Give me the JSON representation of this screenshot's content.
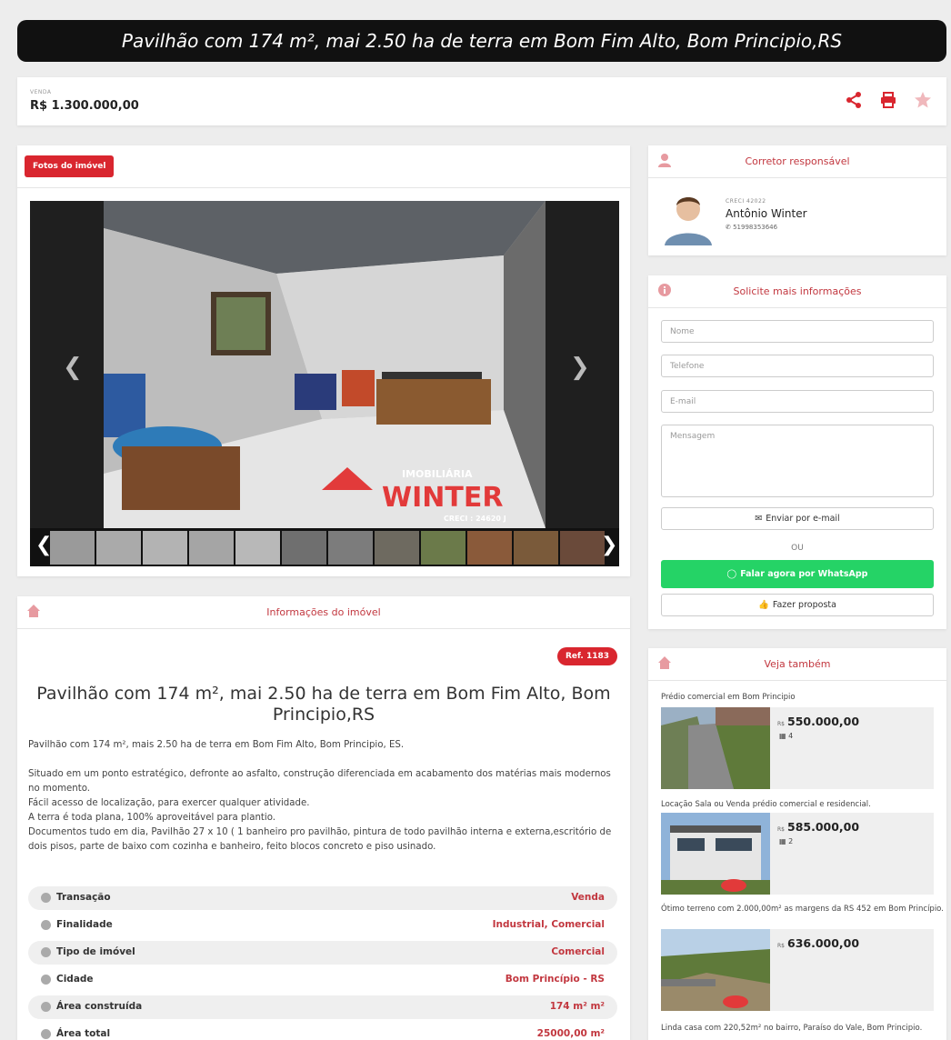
{
  "header": {
    "title": "Pavilhão com 174 m², mai 2.50 ha de terra em Bom Fim Alto, Bom Principio,RS"
  },
  "price": {
    "label": "VENDA",
    "value": "R$ 1.300.000,00"
  },
  "photos": {
    "button": "Fotos do imóvel",
    "watermark_brand": "IMOBILIÁRIA",
    "watermark_name": "WINTER",
    "watermark_creci": "CRECI : 24620 J"
  },
  "info": {
    "title": "Informações do imóvel",
    "ref": "Ref. 1183",
    "heading": "Pavilhão com 174 m², mai 2.50 ha de terra em Bom Fim Alto, Bom Principio,RS",
    "desc1": "Pavilhão com 174 m², mais 2.50 ha de terra em Bom Fim Alto, Bom Principio, ES.",
    "desc2": "Situado em um ponto estratégico, defronte ao asfalto, construção diferenciada em acabamento dos matérias mais modernos no momento.",
    "desc3": "Fácil acesso de localização, para exercer qualquer atividade.",
    "desc4": "A terra é toda plana, 100% aproveitável para plantio.",
    "desc5": "Documentos tudo em dia, Pavilhão 27 x 10 ( 1 banheiro pro pavilhão, pintura de todo pavilhão interna e externa,escritório de dois pisos, parte de baixo com cozinha e banheiro, feito blocos concreto e piso usinado.",
    "features": [
      {
        "label": "Transação",
        "value": "Venda"
      },
      {
        "label": "Finalidade",
        "value": "Industrial, Comercial"
      },
      {
        "label": "Tipo de imóvel",
        "value": "Comercial"
      },
      {
        "label": "Cidade",
        "value": "Bom Princípio - RS"
      },
      {
        "label": "Área construída",
        "value": "174 m² m²"
      },
      {
        "label": "Área total",
        "value": "25000,00 m²"
      }
    ]
  },
  "broker": {
    "title": "Corretor responsável",
    "creci": "CRECI 42022",
    "name": "Antônio Winter",
    "phone": "51998353646"
  },
  "form": {
    "title": "Solicite mais informações",
    "name_ph": "Nome",
    "phone_ph": "Telefone",
    "email_ph": "E-mail",
    "message_ph": "Mensagem",
    "email_btn": "Enviar por e-mail",
    "or": "OU",
    "whatsapp_btn": "Falar agora por WhatsApp",
    "proposal_btn": "Fazer proposta"
  },
  "related": {
    "title": "Veja também",
    "items": [
      {
        "title": "Prédio comercial em Bom Principio",
        "currency": "R$",
        "price": "550.000,00",
        "sub": "4"
      },
      {
        "title": "Locação Sala ou Venda prédio comercial e residencial.",
        "currency": "R$",
        "price": "585.000,00",
        "sub": "2"
      },
      {
        "title": "Ótimo terreno com 2.000,00m² as margens da RS 452 em Bom Princípio.",
        "currency": "R$",
        "price": "636.000,00",
        "sub": ""
      },
      {
        "title": "Linda casa com 220,52m² no bairro, Paraíso do Vale, Bom Principio.",
        "currency": "",
        "price": "",
        "sub": ""
      }
    ]
  },
  "colors": {
    "accent": "#c2373f",
    "button_red": "#d9262f",
    "whatsapp": "#25d366"
  }
}
